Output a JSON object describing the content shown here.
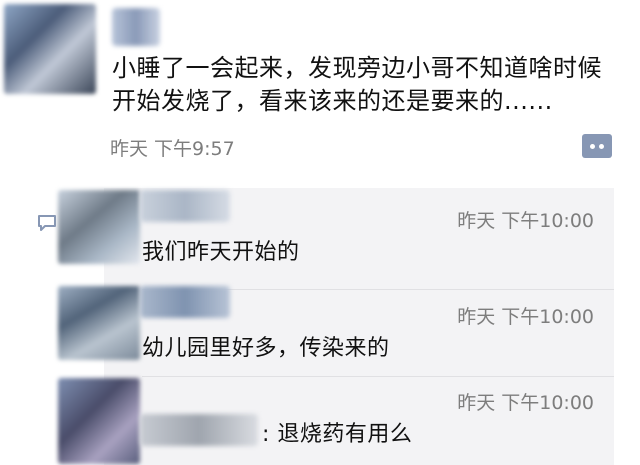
{
  "post": {
    "text": "小睡了一会起来，发现旁边小哥不知道啥时候开始发烧了，看来该来的还是要来的......",
    "time": "昨天  下午9:57"
  },
  "comments": [
    {
      "time": "昨天  下午10:00",
      "text": "我们昨天开始的"
    },
    {
      "time": "昨天  下午10:00",
      "text": "幼儿园里好多，传染来的"
    },
    {
      "time": "昨天  下午10:00",
      "text": ": 退烧药有用么"
    }
  ],
  "colors": {
    "link_blue": "#8797b4",
    "comment_bg": "#f3f3f5",
    "time_gray": "#7d7d7d"
  },
  "icons": {
    "more": "more-dots-icon",
    "comment": "comment-bubble-icon"
  }
}
